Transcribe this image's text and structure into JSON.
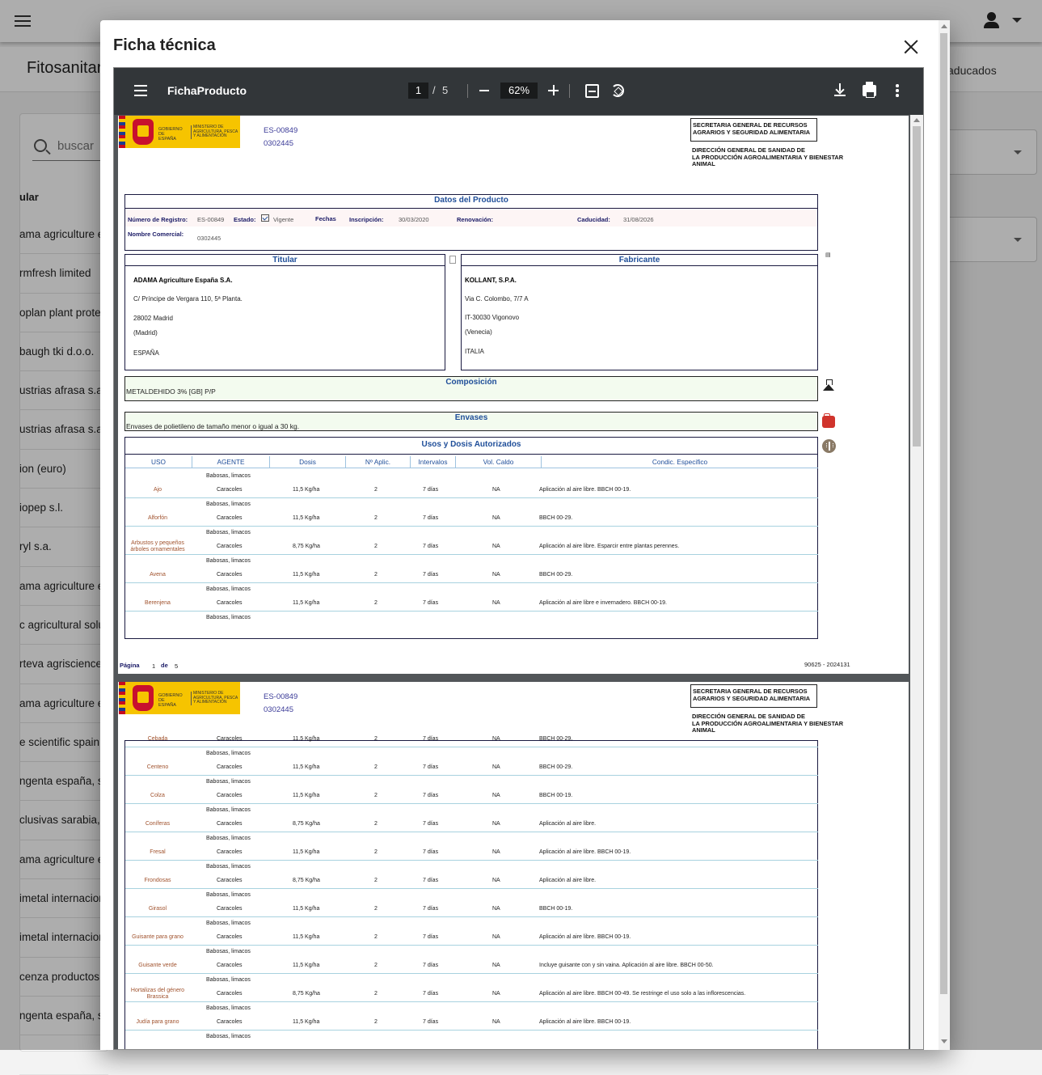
{
  "app": {
    "page_title": "Fitosanitar",
    "tab_caducados": "aducados",
    "search_placeholder": "buscar",
    "column_header": "ular",
    "list_rows": [
      "ama agriculture e",
      "rmfresh limited",
      "oplan plant protec",
      "baugh tki d.o.o.",
      "ustrias afrasa s.a",
      "ustrias afrasa s.a",
      "ion (euro)",
      "iopep s.l.",
      "ryl s.a.",
      "ama agriculture e",
      "c agricultural solu",
      "rteva agriscience",
      "ama agriculture e",
      "e scientific spain s",
      "ngenta españa, s.",
      "clusivas sarabia, s",
      "ama agriculture e",
      "imetal internacion",
      "imetal internacion",
      "cenza productos p",
      "ngenta españa, s.",
      ""
    ]
  },
  "dialog": {
    "title": "Ficha técnica",
    "close_icon": "close-icon"
  },
  "viewer": {
    "doc_title": "FichaProducto",
    "current_page": "1",
    "page_separator": "/",
    "total_pages": "5",
    "zoom": "62%"
  },
  "doc": {
    "logo_gob": "GOBIERNO DE ESPAÑA",
    "logo_min": "MINISTERIO DE AGRICULTURA, PESCA Y ALIMENTACIÓN",
    "reg_number": "ES-00849",
    "reg_code": "0302445",
    "secretaria": "SECRETARIA GENERAL DE  RECURSOS AGRARIOS Y SEGURIDAD ALIMENTARIA",
    "direccion_1": "DIRECCIÓN GENERAL DE SANIDAD DE",
    "direccion_2": "LA PRODUCCIÓN AGROALIMENTARIA Y BIENESTAR",
    "direccion_3": "ANIMAL",
    "datos_title": "Datos del Producto",
    "lbl_numero": "Número de Registro:",
    "val_numero": "ES-00849",
    "lbl_estado": "Estado:",
    "val_estado": "Vigente",
    "lbl_fechas": "Fechas",
    "lbl_inscripcion": "Inscripción:",
    "val_inscripcion": "30/03/2020",
    "lbl_renovacion": "Renovación:",
    "lbl_caducidad": "Caducidad:",
    "val_caducidad": "31/08/2026",
    "lbl_nombre": "Nombre Comercial:",
    "val_nombre": "0302445",
    "titular_title": "Titular",
    "titular_name": "ADAMA Agriculture España S.A.",
    "titular_addr": "C/ Príncipe de Vergara 110, 5ª Planta.",
    "titular_city": "28002 Madrid",
    "titular_prov": "(Madrid)",
    "titular_country": "ESPAÑA",
    "fabricante_title": "Fabricante",
    "fab_name": "KOLLANT, S.P.A.",
    "fab_addr": "Via C. Colombo, 7/7 A",
    "fab_city": " IT-30030 Vigonovo",
    "fab_prov": "(Venecia)",
    "fab_country": "ITALIA",
    "composicion_title": "Composición",
    "composicion_text": "METALDEHIDO 3% [GB] P/P",
    "envases_title": "Envases",
    "envases_text": "Envases de polietileno de tamaño menor o igual a 30 kg.",
    "usos_title": "Usos y Dosis Autorizados",
    "columns": [
      "USO",
      "AGENTE",
      "Dosis",
      "Nº Aplic.",
      "Intervalos",
      "Vol. Caldo",
      "Condic. Especifico"
    ],
    "footer_pagina": "Página",
    "footer_num": "1",
    "footer_de": "de",
    "footer_total": "5",
    "footer_code": "90625 -   2024131",
    "rows_page1": [
      {
        "uso": "Ajo",
        "a1": "Babosas, limacos",
        "a2": "Caracoles",
        "dosis": "11,5 Kg/ha",
        "n": "2",
        "i": "7 días",
        "v": "NA",
        "c": "Aplicación al aire libre. BBCH 00-19."
      },
      {
        "uso": "Alforfón",
        "a1": "Babosas, limacos",
        "a2": "Caracoles",
        "dosis": "11,5 Kg/ha",
        "n": "2",
        "i": "7 días",
        "v": "NA",
        "c": " BBCH 00-29."
      },
      {
        "uso": "Arbustos y pequeños árboles ornamentales",
        "a1": "Babosas, limacos",
        "a2": "Caracoles",
        "dosis": "8,75 Kg/ha",
        "n": "2",
        "i": "7 días",
        "v": "NA",
        "c": "Aplicación al aire libre. Esparcir entre plantas perennes."
      },
      {
        "uso": "Avena",
        "a1": "Babosas, limacos",
        "a2": "Caracoles",
        "dosis": "11,5 Kg/ha",
        "n": "2",
        "i": "7 días",
        "v": "NA",
        "c": " BBCH 00-29."
      },
      {
        "uso": "Berenjena",
        "a1": "Babosas, limacos",
        "a2": "Caracoles",
        "dosis": "11,5 Kg/ha",
        "n": "2",
        "i": "7 días",
        "v": "NA",
        "c": "Aplicación al aire libre e invernadero. BBCH 00-19."
      },
      {
        "uso": "",
        "a1": "Babosas, limacos",
        "a2": "",
        "dosis": "",
        "n": "",
        "i": "",
        "v": "",
        "c": ""
      }
    ],
    "rows_page2": [
      {
        "uso": "Cebada",
        "a1": "",
        "a2": "Caracoles",
        "dosis": "11,5 Kg/ha",
        "n": "2",
        "i": "7 días",
        "v": "NA",
        "c": " BBCH 00-29."
      },
      {
        "uso": "Centeno",
        "a1": "Babosas, limacos",
        "a2": "Caracoles",
        "dosis": "11,5 Kg/ha",
        "n": "2",
        "i": "7 días",
        "v": "NA",
        "c": " BBCH 00-29."
      },
      {
        "uso": "Colza",
        "a1": "Babosas, limacos",
        "a2": "Caracoles",
        "dosis": "11,5 Kg/ha",
        "n": "2",
        "i": "7 días",
        "v": "NA",
        "c": " BBCH 00-19."
      },
      {
        "uso": "Coníferas",
        "a1": "Babosas, limacos",
        "a2": "Caracoles",
        "dosis": "8,75 Kg/ha",
        "n": "2",
        "i": "7 días",
        "v": "NA",
        "c": "Aplicación al aire libre."
      },
      {
        "uso": "Fresal",
        "a1": "Babosas, limacos",
        "a2": "Caracoles",
        "dosis": "11,5 Kg/ha",
        "n": "2",
        "i": "7 días",
        "v": "NA",
        "c": "Aplicación al aire libre. BBCH 00-19."
      },
      {
        "uso": "Frondosas",
        "a1": "Babosas, limacos",
        "a2": "Caracoles",
        "dosis": "8,75 Kg/ha",
        "n": "2",
        "i": "7 días",
        "v": "NA",
        "c": "Aplicación al aire libre."
      },
      {
        "uso": "Girasol",
        "a1": "Babosas, limacos",
        "a2": "Caracoles",
        "dosis": "11,5 Kg/ha",
        "n": "2",
        "i": "7 días",
        "v": "NA",
        "c": " BBCH 00-19."
      },
      {
        "uso": "Guisante para grano",
        "a1": "Babosas, limacos",
        "a2": "Caracoles",
        "dosis": "11,5 Kg/ha",
        "n": "2",
        "i": "7 días",
        "v": "NA",
        "c": "Aplicación al aire libre. BBCH 00-19."
      },
      {
        "uso": "Guisante verde",
        "a1": "Babosas, limacos",
        "a2": "Caracoles",
        "dosis": "11,5 Kg/ha",
        "n": "2",
        "i": "7 días",
        "v": "NA",
        "c": "Incluye guisante con y sin vaina. Aplicación al aire libre. BBCH 00-50."
      },
      {
        "uso": "Hortalizas del género Brassica",
        "a1": "Babosas, limacos",
        "a2": "Caracoles",
        "dosis": "8,75 Kg/ha",
        "n": "2",
        "i": "7 días",
        "v": "NA",
        "c": "Aplicación al aire libre. BBCH 00-49. Se restringe el uso solo a las inflorescencias."
      },
      {
        "uso": "Judía para grano",
        "a1": "Babosas, limacos",
        "a2": "Caracoles",
        "dosis": "11,5 Kg/ha",
        "n": "2",
        "i": "7 días",
        "v": "NA",
        "c": "Aplicación al aire libre. BBCH 00-19."
      },
      {
        "uso": "",
        "a1": "Babosas, limacos",
        "a2": "",
        "dosis": "",
        "n": "",
        "i": "",
        "v": "",
        "c": ""
      }
    ]
  }
}
